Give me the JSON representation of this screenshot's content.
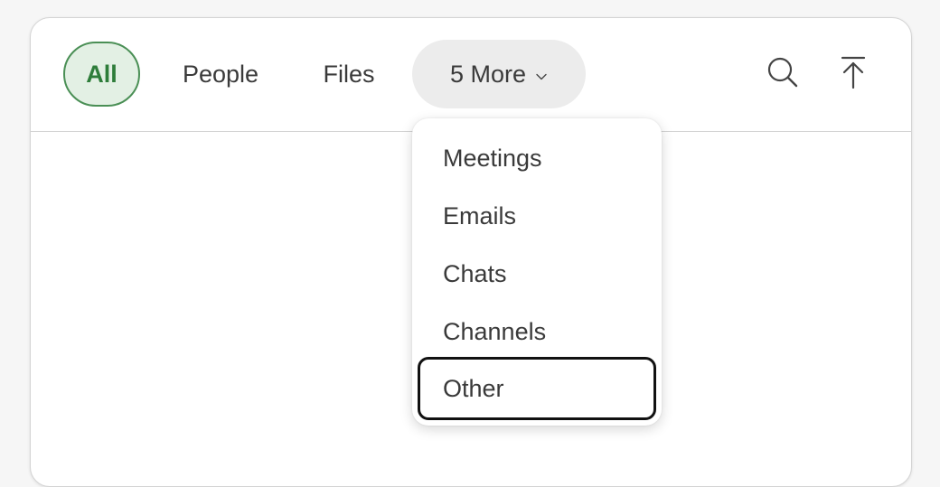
{
  "filters": {
    "all_label": "All",
    "people_label": "People",
    "files_label": "Files",
    "more_label": "5 More"
  },
  "icons": {
    "search": "search-icon",
    "upload": "arrow-up-to-line-icon",
    "chevron": "chevron-down-icon"
  },
  "more_menu": {
    "items": [
      {
        "label": "Meetings"
      },
      {
        "label": "Emails"
      },
      {
        "label": "Chats"
      },
      {
        "label": "Channels"
      },
      {
        "label": "Other"
      }
    ],
    "focused_item": "Other"
  },
  "colors": {
    "accent_green": "#2e7d3a",
    "accent_green_bg": "#e3f0e4",
    "focus_ring": "#111111"
  }
}
